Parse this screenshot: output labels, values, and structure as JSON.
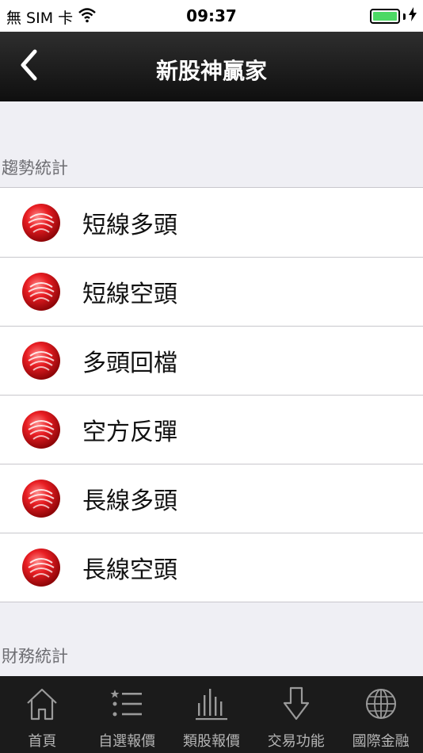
{
  "status_bar": {
    "carrier": "無 SIM 卡",
    "time": "09:37",
    "icons": [
      "wifi-icon",
      "battery-icon",
      "charging-bolt-icon"
    ]
  },
  "nav": {
    "title": "新股神贏家",
    "back_icon": "chevron-left-icon"
  },
  "sections": [
    {
      "header": "趨勢統計",
      "items": [
        {
          "label": "短線多頭",
          "icon": "red-ball-icon"
        },
        {
          "label": "短線空頭",
          "icon": "red-ball-icon"
        },
        {
          "label": "多頭回檔",
          "icon": "red-ball-icon"
        },
        {
          "label": "空方反彈",
          "icon": "red-ball-icon"
        },
        {
          "label": "長線多頭",
          "icon": "red-ball-icon"
        },
        {
          "label": "長線空頭",
          "icon": "red-ball-icon"
        }
      ]
    },
    {
      "header": "財務統計",
      "items": []
    }
  ],
  "tab_bar": {
    "tabs": [
      {
        "label": "首頁",
        "icon": "home-icon"
      },
      {
        "label": "自選報價",
        "icon": "star-list-icon"
      },
      {
        "label": "類股報價",
        "icon": "bar-chart-icon"
      },
      {
        "label": "交易功能",
        "icon": "down-arrow-icon"
      },
      {
        "label": "國際金融",
        "icon": "globe-icon"
      }
    ]
  },
  "colors": {
    "nav_background": "#1a1a1a",
    "tab_background": "#1b1b1b",
    "ball_red": "#e0161b",
    "battery_green": "#4cd964",
    "page_background": "#efeff4"
  }
}
